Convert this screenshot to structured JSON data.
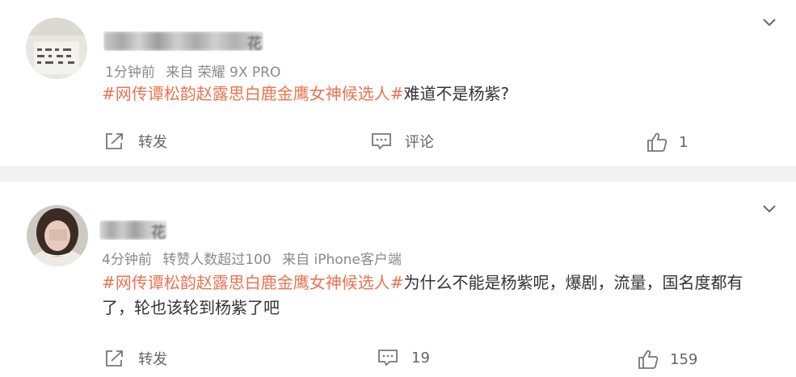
{
  "comments": [
    {
      "username": "花",
      "time": "1分钟前",
      "source": "来自 荣耀 9X PRO",
      "extra": "",
      "topic": "#网传谭松韵赵露思白鹿金鹰女神候选人#",
      "text": "难道不是杨紫?",
      "repost_label": "转发",
      "comment_label": "评论",
      "like_count": "1"
    },
    {
      "username": "花",
      "time": "4分钟前",
      "source": "来自 iPhone客户端",
      "extra": "转赞人数超过100",
      "topic": "#网传谭松韵赵露思白鹿金鹰女神候选人#",
      "text": "为什么不能是杨紫呢，爆剧，流量，国名度都有了，轮也该轮到杨紫了吧",
      "repost_label": "转发",
      "comment_label": "19",
      "like_count": "159"
    }
  ],
  "icons": {
    "more": "chevron-down-icon",
    "repost": "share-icon",
    "comment": "comment-icon",
    "like": "thumbs-up-icon"
  },
  "colors": {
    "topic": "#eb7350",
    "meta": "#8a8a8a",
    "background": "#f1f2f5"
  }
}
